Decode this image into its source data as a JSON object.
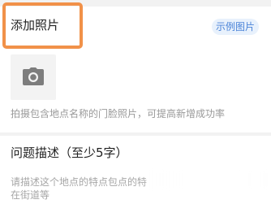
{
  "photo_section": {
    "title": "添加照片",
    "example_label": "示例图片",
    "hint": "拍摄包含地点名称的门脸照片，可提高新增成功率"
  },
  "description_section": {
    "title": "问题描述（至少5字）",
    "placeholder_line1": "请描述这个地点的特点包点的特",
    "placeholder_line2": "在街道等"
  },
  "icons": {
    "add_photo": "camera-icon"
  },
  "colors": {
    "highlight": "#f19149",
    "tag_text": "#4a83d8",
    "tag_bg": "#e8f1fc"
  }
}
